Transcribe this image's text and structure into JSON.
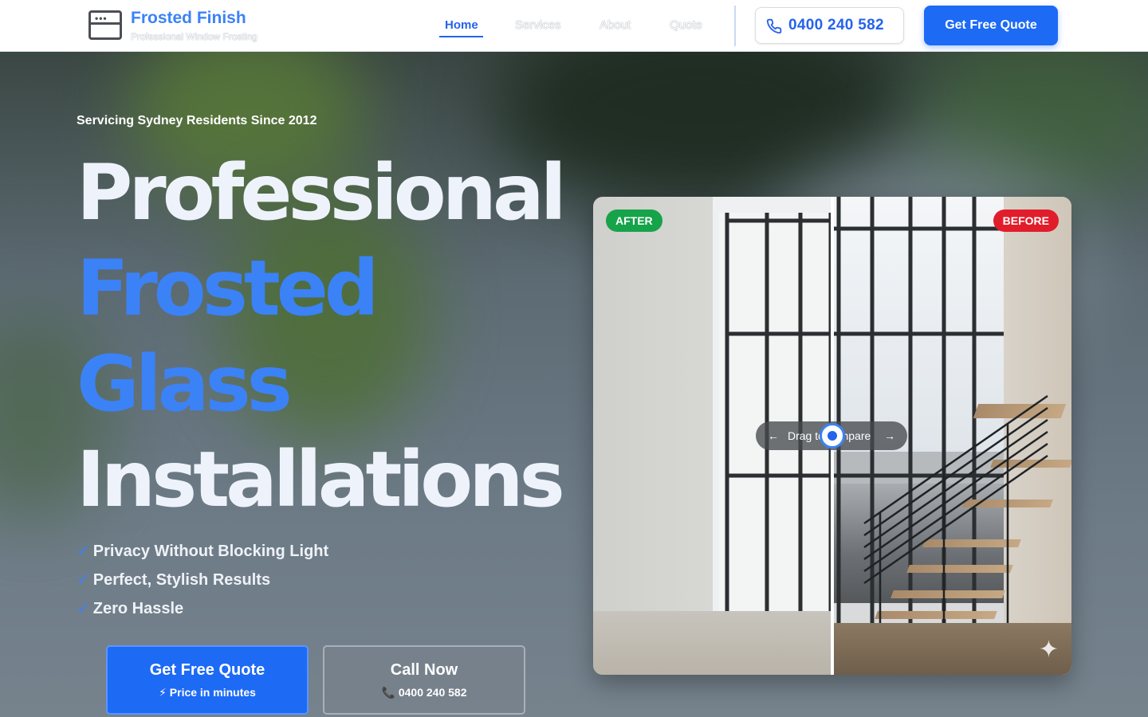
{
  "header": {
    "brand_name": "Frosted Finish",
    "brand_tagline": "Professional Window Frosting",
    "nav": [
      "Home",
      "Services",
      "About",
      "Quote"
    ],
    "active_nav": "Home",
    "phone": "0400 240 582",
    "cta": "Get Free Quote"
  },
  "hero": {
    "eyebrow": "Servicing Sydney Residents Since 2012",
    "headline": [
      "Professional",
      "Frosted",
      "Glass",
      "Installations"
    ],
    "benefits": [
      "Privacy Without Blocking Light",
      "Perfect, Stylish Results",
      "Zero Hassle"
    ],
    "check_glyph": "✓",
    "primary_button": {
      "label": "Get Free Quote",
      "sub": "⚡ Price in minutes"
    },
    "secondary_button": {
      "label": "Call Now",
      "sub": "📞 0400 240 582"
    }
  },
  "compare": {
    "after_label": "AFTER",
    "before_label": "BEFORE",
    "drag_hint": "Drag to compare",
    "arrow_left": "←",
    "arrow_right": "→",
    "sparkle": "✦",
    "slider_position": 0.5
  },
  "colors": {
    "accent": "#2563eb",
    "brand": "#3b82f6",
    "after_badge": "#16a34a",
    "before_badge": "#e11d2b"
  },
  "icons": [
    "window-logo-icon",
    "phone-icon",
    "check-icon",
    "bolt-icon",
    "sparkle-icon",
    "arrow-left-icon",
    "arrow-right-icon"
  ]
}
